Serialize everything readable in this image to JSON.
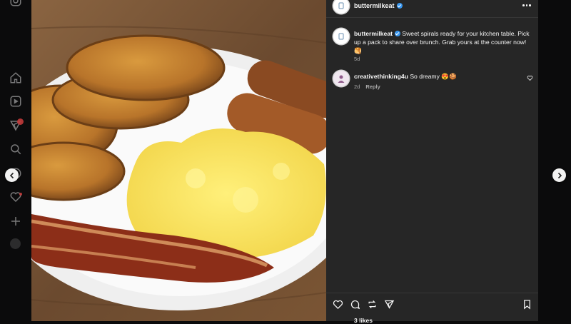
{
  "post": {
    "username": "buttermilkeat",
    "caption": "Sweet spirals ready for your kitchen table. Pick up a pack to share over brunch. Grab yours at the counter now! 🥞",
    "caption_time": "5d",
    "comments": [
      {
        "username": "creativethinking4u",
        "text": "So dreamy 😍🍪",
        "time": "2d",
        "reply_label": "Reply"
      }
    ],
    "likes_label": "3 likes"
  },
  "icons": {
    "sidebar": [
      "instagram-icon",
      "home-icon",
      "reels-icon",
      "messages-icon",
      "search-icon",
      "explore-icon",
      "notifications-icon",
      "create-icon",
      "profile-icon"
    ],
    "actions": [
      "heart-icon",
      "comment-icon",
      "repost-icon",
      "share-icon",
      "save-icon"
    ]
  },
  "colors": {
    "panel_bg": "#262626",
    "backdrop": "#0b0b0c",
    "verified": "#3897f0",
    "notification": "#c23a3a"
  }
}
